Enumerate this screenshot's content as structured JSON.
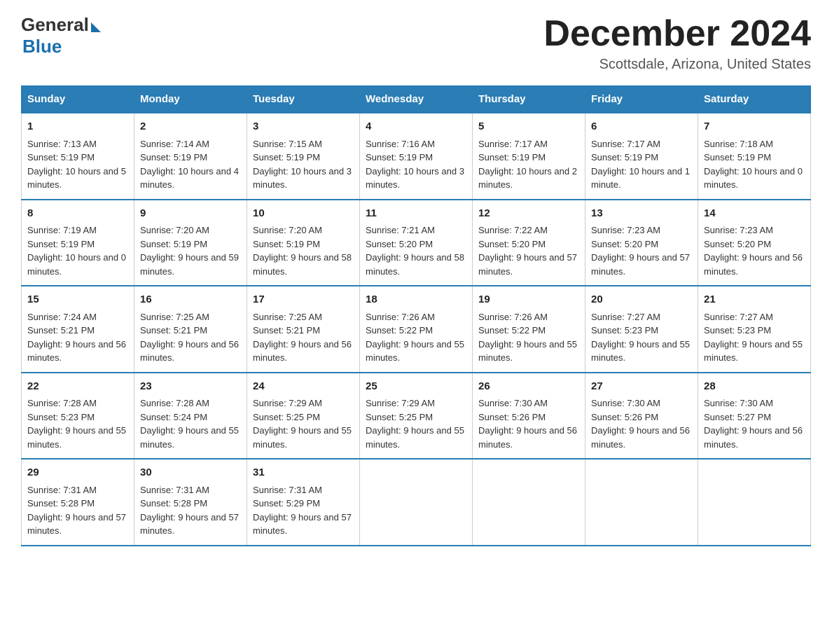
{
  "header": {
    "logo_general": "General",
    "logo_blue": "Blue",
    "title": "December 2024",
    "subtitle": "Scottsdale, Arizona, United States"
  },
  "days_of_week": [
    "Sunday",
    "Monday",
    "Tuesday",
    "Wednesday",
    "Thursday",
    "Friday",
    "Saturday"
  ],
  "weeks": [
    [
      {
        "num": "1",
        "sunrise": "7:13 AM",
        "sunset": "5:19 PM",
        "daylight": "10 hours and 5 minutes."
      },
      {
        "num": "2",
        "sunrise": "7:14 AM",
        "sunset": "5:19 PM",
        "daylight": "10 hours and 4 minutes."
      },
      {
        "num": "3",
        "sunrise": "7:15 AM",
        "sunset": "5:19 PM",
        "daylight": "10 hours and 3 minutes."
      },
      {
        "num": "4",
        "sunrise": "7:16 AM",
        "sunset": "5:19 PM",
        "daylight": "10 hours and 3 minutes."
      },
      {
        "num": "5",
        "sunrise": "7:17 AM",
        "sunset": "5:19 PM",
        "daylight": "10 hours and 2 minutes."
      },
      {
        "num": "6",
        "sunrise": "7:17 AM",
        "sunset": "5:19 PM",
        "daylight": "10 hours and 1 minute."
      },
      {
        "num": "7",
        "sunrise": "7:18 AM",
        "sunset": "5:19 PM",
        "daylight": "10 hours and 0 minutes."
      }
    ],
    [
      {
        "num": "8",
        "sunrise": "7:19 AM",
        "sunset": "5:19 PM",
        "daylight": "10 hours and 0 minutes."
      },
      {
        "num": "9",
        "sunrise": "7:20 AM",
        "sunset": "5:19 PM",
        "daylight": "9 hours and 59 minutes."
      },
      {
        "num": "10",
        "sunrise": "7:20 AM",
        "sunset": "5:19 PM",
        "daylight": "9 hours and 58 minutes."
      },
      {
        "num": "11",
        "sunrise": "7:21 AM",
        "sunset": "5:20 PM",
        "daylight": "9 hours and 58 minutes."
      },
      {
        "num": "12",
        "sunrise": "7:22 AM",
        "sunset": "5:20 PM",
        "daylight": "9 hours and 57 minutes."
      },
      {
        "num": "13",
        "sunrise": "7:23 AM",
        "sunset": "5:20 PM",
        "daylight": "9 hours and 57 minutes."
      },
      {
        "num": "14",
        "sunrise": "7:23 AM",
        "sunset": "5:20 PM",
        "daylight": "9 hours and 56 minutes."
      }
    ],
    [
      {
        "num": "15",
        "sunrise": "7:24 AM",
        "sunset": "5:21 PM",
        "daylight": "9 hours and 56 minutes."
      },
      {
        "num": "16",
        "sunrise": "7:25 AM",
        "sunset": "5:21 PM",
        "daylight": "9 hours and 56 minutes."
      },
      {
        "num": "17",
        "sunrise": "7:25 AM",
        "sunset": "5:21 PM",
        "daylight": "9 hours and 56 minutes."
      },
      {
        "num": "18",
        "sunrise": "7:26 AM",
        "sunset": "5:22 PM",
        "daylight": "9 hours and 55 minutes."
      },
      {
        "num": "19",
        "sunrise": "7:26 AM",
        "sunset": "5:22 PM",
        "daylight": "9 hours and 55 minutes."
      },
      {
        "num": "20",
        "sunrise": "7:27 AM",
        "sunset": "5:23 PM",
        "daylight": "9 hours and 55 minutes."
      },
      {
        "num": "21",
        "sunrise": "7:27 AM",
        "sunset": "5:23 PM",
        "daylight": "9 hours and 55 minutes."
      }
    ],
    [
      {
        "num": "22",
        "sunrise": "7:28 AM",
        "sunset": "5:23 PM",
        "daylight": "9 hours and 55 minutes."
      },
      {
        "num": "23",
        "sunrise": "7:28 AM",
        "sunset": "5:24 PM",
        "daylight": "9 hours and 55 minutes."
      },
      {
        "num": "24",
        "sunrise": "7:29 AM",
        "sunset": "5:25 PM",
        "daylight": "9 hours and 55 minutes."
      },
      {
        "num": "25",
        "sunrise": "7:29 AM",
        "sunset": "5:25 PM",
        "daylight": "9 hours and 55 minutes."
      },
      {
        "num": "26",
        "sunrise": "7:30 AM",
        "sunset": "5:26 PM",
        "daylight": "9 hours and 56 minutes."
      },
      {
        "num": "27",
        "sunrise": "7:30 AM",
        "sunset": "5:26 PM",
        "daylight": "9 hours and 56 minutes."
      },
      {
        "num": "28",
        "sunrise": "7:30 AM",
        "sunset": "5:27 PM",
        "daylight": "9 hours and 56 minutes."
      }
    ],
    [
      {
        "num": "29",
        "sunrise": "7:31 AM",
        "sunset": "5:28 PM",
        "daylight": "9 hours and 57 minutes."
      },
      {
        "num": "30",
        "sunrise": "7:31 AM",
        "sunset": "5:28 PM",
        "daylight": "9 hours and 57 minutes."
      },
      {
        "num": "31",
        "sunrise": "7:31 AM",
        "sunset": "5:29 PM",
        "daylight": "9 hours and 57 minutes."
      },
      null,
      null,
      null,
      null
    ]
  ]
}
